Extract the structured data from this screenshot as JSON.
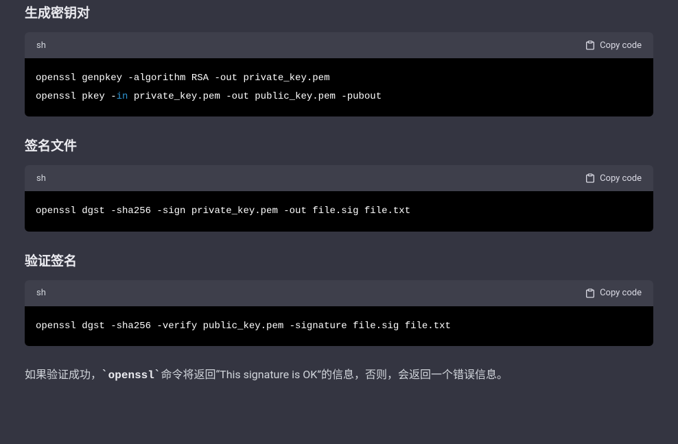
{
  "sections": [
    {
      "heading": "生成密钥对",
      "lang": "sh",
      "copy_label": "Copy code",
      "code_tokens": [
        {
          "t": "openssl genpkey -algorithm RSA -out private_key.pem\nopenssl pkey -",
          "c": null
        },
        {
          "t": "in",
          "c": "tok-in"
        },
        {
          "t": " private_key.pem -out public_key.pem -pubout",
          "c": null
        }
      ]
    },
    {
      "heading": "签名文件",
      "lang": "sh",
      "copy_label": "Copy code",
      "code_tokens": [
        {
          "t": "openssl dgst -sha256 -sign private_key.pem -out file.sig file.txt",
          "c": null
        }
      ]
    },
    {
      "heading": "验证签名",
      "lang": "sh",
      "copy_label": "Copy code",
      "code_tokens": [
        {
          "t": "openssl dgst -sha256 -verify public_key.pem -signature file.sig file.txt",
          "c": null
        }
      ]
    }
  ],
  "footer": {
    "pre": "如果验证成功，",
    "tick1": "`",
    "code": "openssl",
    "tick2": "`",
    "post": "命令将返回“This signature is OK”的信息，否则，会返回一个错误信息。"
  }
}
